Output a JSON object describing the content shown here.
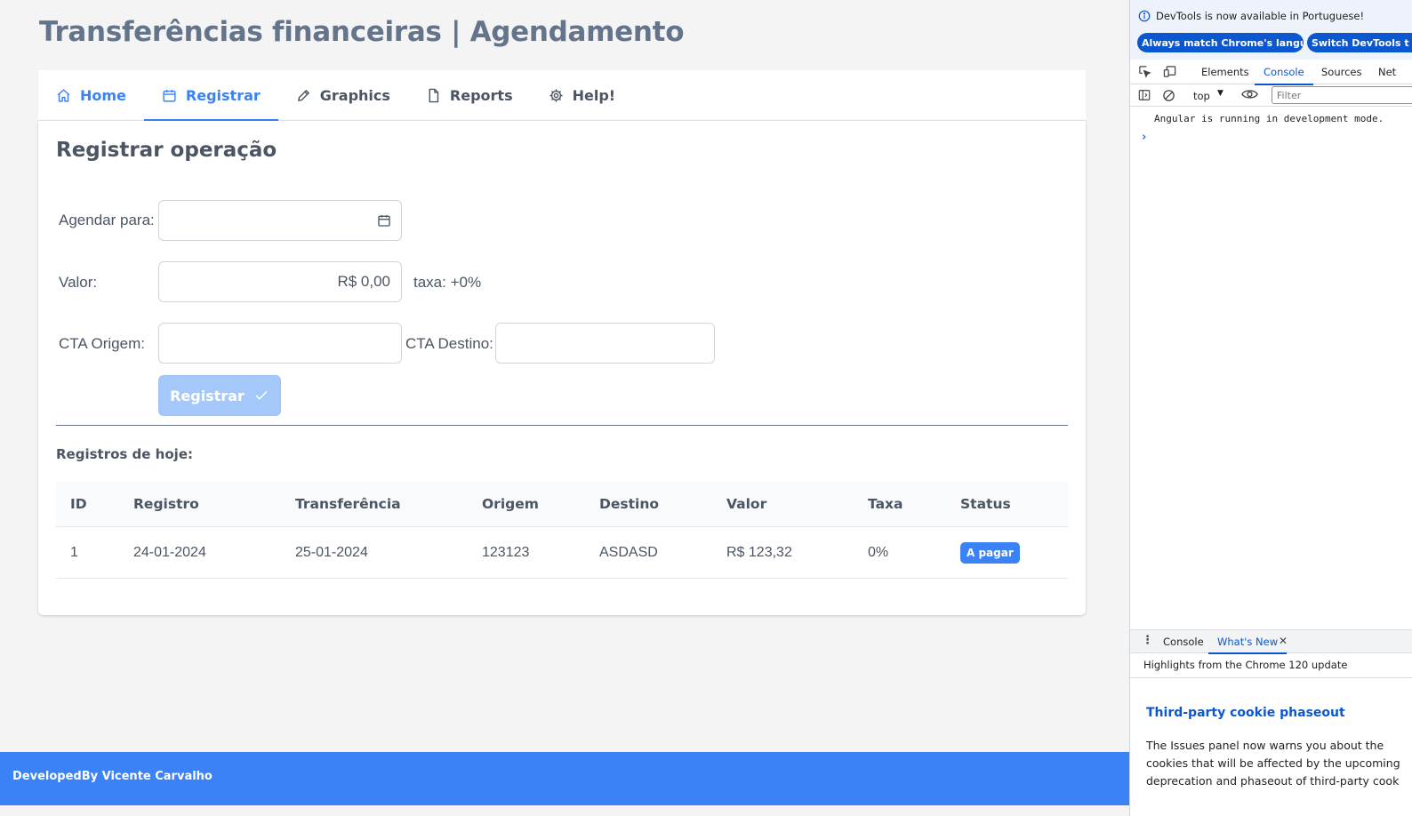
{
  "app": {
    "title": "Transferências financeiras | Agendamento",
    "tabs": [
      {
        "label": "Home",
        "icon": "home-icon",
        "active": false
      },
      {
        "label": "Registrar",
        "icon": "calendar-icon",
        "active": true
      },
      {
        "label": "Graphics",
        "icon": "pencil-icon",
        "active": false
      },
      {
        "label": "Reports",
        "icon": "file-icon",
        "active": false
      },
      {
        "label": "Help!",
        "icon": "gear-icon",
        "active": false
      }
    ],
    "form": {
      "title": "Registrar operação",
      "agendar_label": "Agendar para:",
      "agendar_value": "",
      "valor_label": "Valor:",
      "valor_value": "R$ 0,00",
      "taxa_text": "taxa: +0%",
      "origem_label": "CTA Origem:",
      "origem_value": "",
      "destino_label": "CTA Destino:",
      "destino_value": "",
      "submit_label": "Registrar"
    },
    "table": {
      "title": "Registros de hoje:",
      "headers": [
        "ID",
        "Registro",
        "Transferência",
        "Origem",
        "Destino",
        "Valor",
        "Taxa",
        "Status"
      ],
      "rows": [
        [
          "1",
          "24-01-2024",
          "25-01-2024",
          "123123",
          "ASDASD",
          "R$ 123,32",
          "0%",
          "A pagar"
        ]
      ]
    },
    "footer": "DevelopedBy Vicente Carvalho",
    "colors": {
      "accent": "#3b82f6",
      "title": "#64748b",
      "disabled_button": "#a5c8fb"
    }
  },
  "devtools": {
    "banner_text": "DevTools is now available in Portuguese!",
    "btn_match": "Always match Chrome's language",
    "btn_switch": "Switch DevTools t",
    "tabs": [
      "Elements",
      "Console",
      "Sources",
      "Net"
    ],
    "active_tab": "Console",
    "context": "top",
    "filter_placeholder": "Filter",
    "console_message": "Angular is running in development mode.",
    "drawer_tabs": [
      "Console",
      "What's New"
    ],
    "drawer_active": "What's New",
    "subtitle": "Highlights from the Chrome 120 update",
    "headline": "Third-party cookie phaseout",
    "body_lines": [
      "The Issues panel now warns you about the",
      "cookies that will be affected by the upcoming",
      "deprecation and phaseout of third-party cook"
    ],
    "colors": {
      "link": "#0b57d0"
    }
  }
}
